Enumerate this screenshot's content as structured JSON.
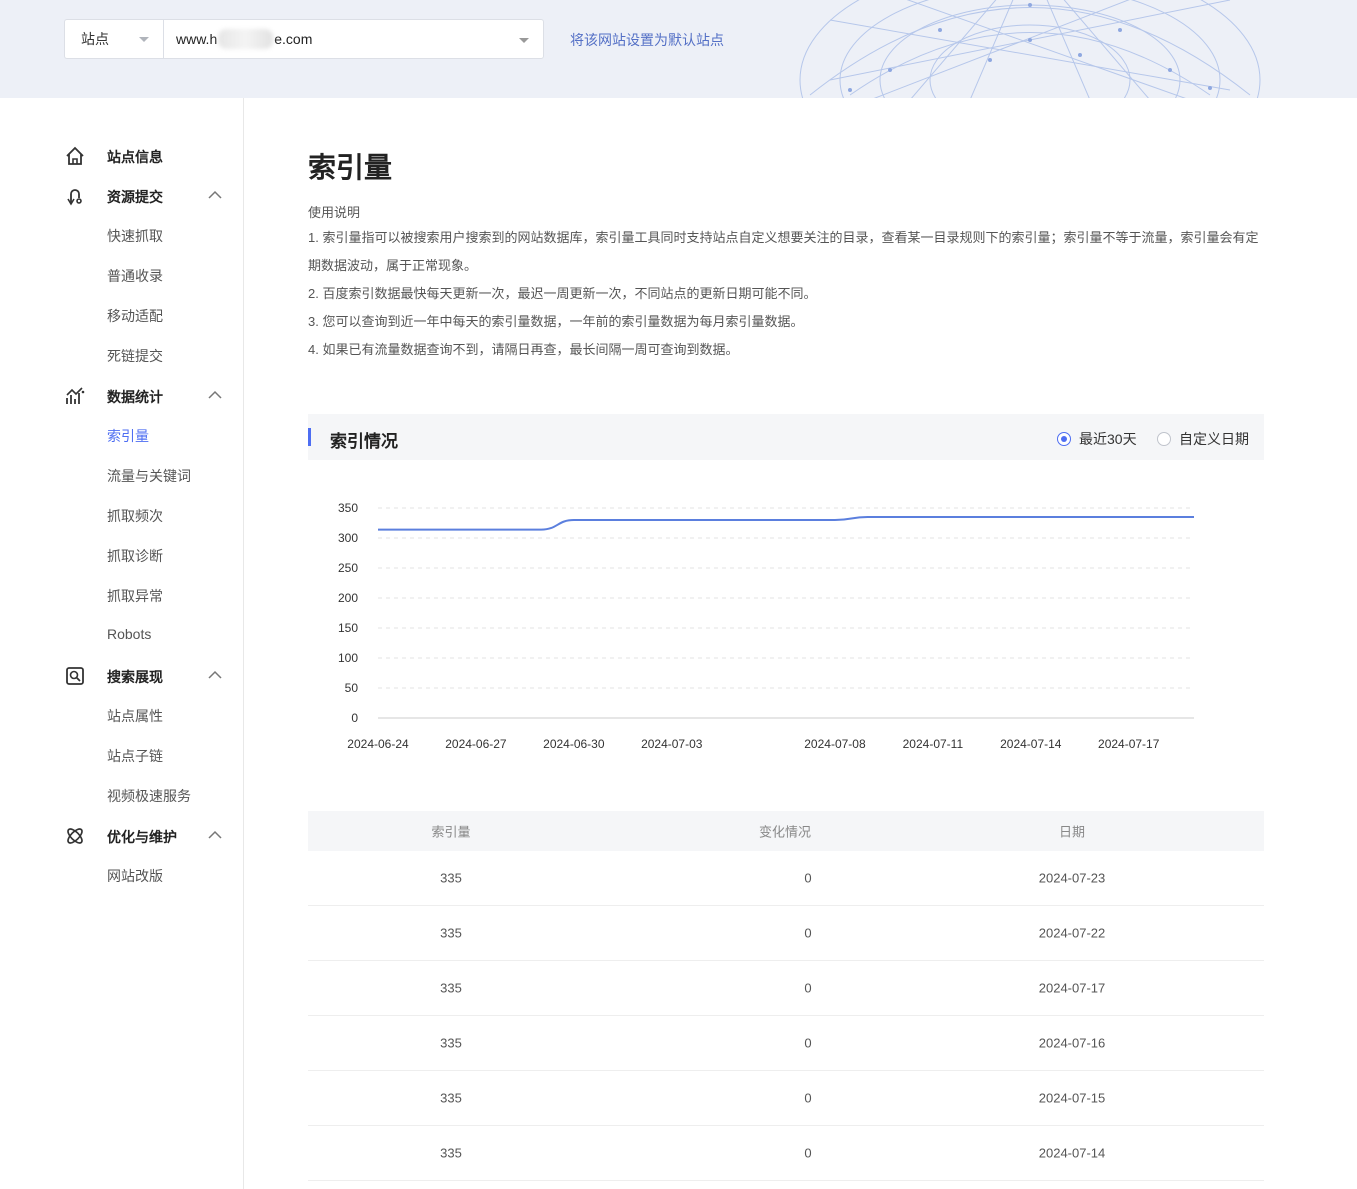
{
  "topbar": {
    "site_label": "站点",
    "url_prefix": "www.h",
    "url_suffix": "e.com",
    "set_default_link": "将该网站设置为默认站点"
  },
  "sidebar": {
    "groups": [
      {
        "label": "站点信息",
        "icon": "home-icon",
        "items": []
      },
      {
        "label": "资源提交",
        "icon": "submit-icon",
        "items": [
          "快速抓取",
          "普通收录",
          "移动适配",
          "死链提交"
        ]
      },
      {
        "label": "数据统计",
        "icon": "stats-icon",
        "items": [
          "索引量",
          "流量与关键词",
          "抓取频次",
          "抓取诊断",
          "抓取异常",
          "Robots"
        ]
      },
      {
        "label": "搜索展现",
        "icon": "search-display-icon",
        "items": [
          "站点属性",
          "站点子链",
          "视频极速服务"
        ]
      },
      {
        "label": "优化与维护",
        "icon": "optimize-icon",
        "items": [
          "网站改版"
        ]
      }
    ],
    "active_item": "索引量"
  },
  "main": {
    "title": "索引量",
    "intro_title": "使用说明",
    "intro_lines": [
      "1. 索引量指可以被搜索用户搜索到的网站数据库，索引量工具同时支持站点自定义想要关注的目录，查看某一目录规则下的索引量；索引量不等于流量，索引量会有定期数据波动，属于正常现象。",
      "2. 百度索引数据最快每天更新一次，最迟一周更新一次，不同站点的更新日期可能不同。",
      "3. 您可以查询到近一年中每天的索引量数据，一年前的索引量数据为每月索引量数据。",
      "4. 如果已有流量数据查询不到，请隔日再查，最长间隔一周可查询到数据。"
    ],
    "section_title": "索引情况",
    "radio_recent": "最近30天",
    "radio_custom": "自定义日期",
    "radio_selected": "最近30天"
  },
  "chart_data": {
    "type": "line",
    "x": [
      "2024-06-24",
      "2024-06-25",
      "2024-06-26",
      "2024-06-27",
      "2024-06-28",
      "2024-06-29",
      "2024-06-30",
      "2024-07-01",
      "2024-07-02",
      "2024-07-03",
      "2024-07-04",
      "2024-07-05",
      "2024-07-06",
      "2024-07-07",
      "2024-07-08",
      "2024-07-09",
      "2024-07-10",
      "2024-07-11",
      "2024-07-12",
      "2024-07-13",
      "2024-07-14",
      "2024-07-15",
      "2024-07-16",
      "2024-07-17",
      "2024-07-22",
      "2024-07-23"
    ],
    "tick_labels": [
      "2024-06-24",
      "2024-06-27",
      "2024-06-30",
      "2024-07-03",
      "2024-07-08",
      "2024-07-11",
      "2024-07-14",
      "2024-07-17"
    ],
    "values": [
      314,
      314,
      314,
      314,
      314,
      314,
      330,
      330,
      330,
      330,
      330,
      330,
      330,
      330,
      330,
      335,
      335,
      335,
      335,
      335,
      335,
      335,
      335,
      335,
      335,
      335
    ],
    "yticks": [
      0,
      50,
      100,
      150,
      200,
      250,
      300,
      350
    ],
    "ylim": [
      0,
      350
    ],
    "color": "#5b7fde",
    "grid": true
  },
  "table": {
    "headers": [
      "索引量",
      "变化情况",
      "日期"
    ],
    "rows": [
      [
        "335",
        "0",
        "2024-07-23"
      ],
      [
        "335",
        "0",
        "2024-07-22"
      ],
      [
        "335",
        "0",
        "2024-07-17"
      ],
      [
        "335",
        "0",
        "2024-07-16"
      ],
      [
        "335",
        "0",
        "2024-07-15"
      ],
      [
        "335",
        "0",
        "2024-07-14"
      ]
    ]
  }
}
